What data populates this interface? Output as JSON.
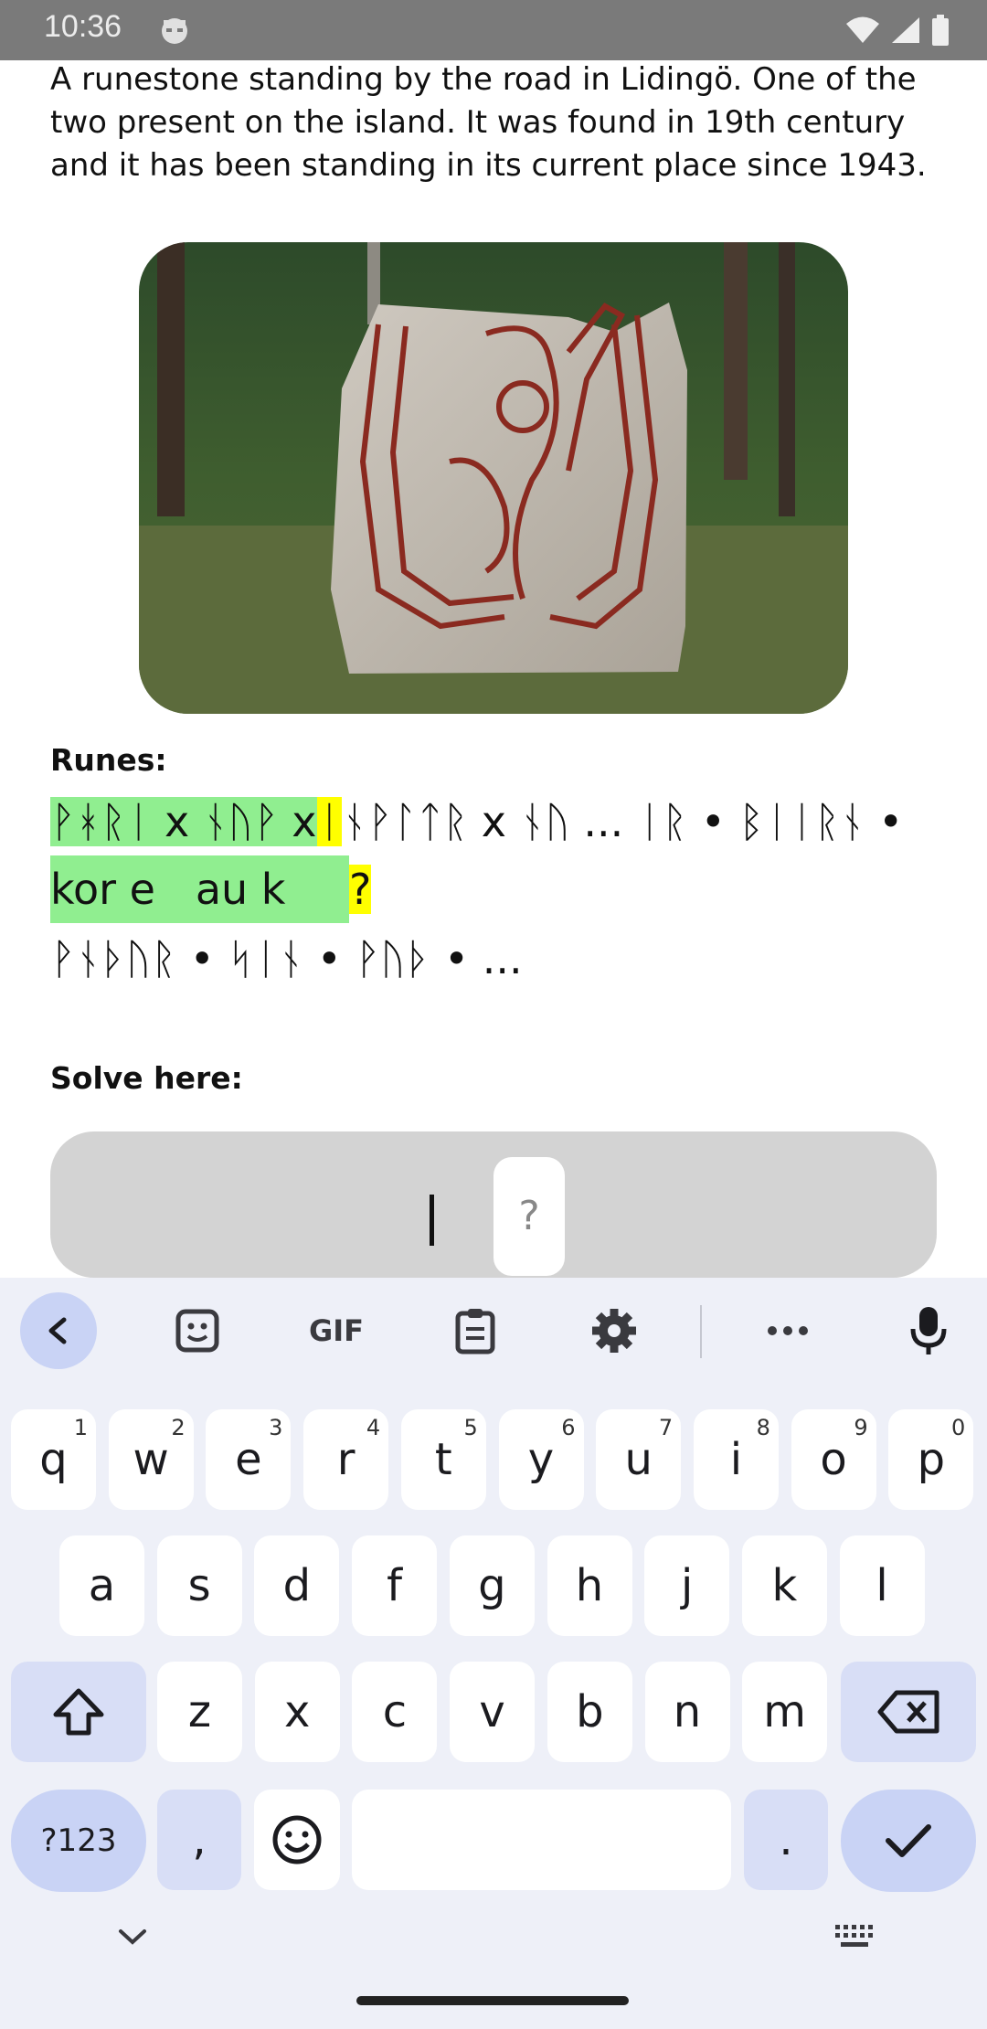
{
  "status": {
    "time": "10:36"
  },
  "content": {
    "description": "A runestone standing by the road in Lidingö. One of the two present on the island. It was found in 19th century and it has been standing in its current place since 1943.",
    "runes_heading": "Runes:",
    "runes": {
      "green": "ᚹᚼᚱᛁ x ᚾᚢᚹ x",
      "yellow": "ᛁ",
      "rest_line1": "ᚾᚹᛚᛏᚱ x ᚾᚢ ... ᛁᚱ • ᛒᛁᛁᚱᚾ •",
      "translit_green": "kor e   au k",
      "translit_yellow": "?",
      "line3": "ᚹᚾᚦᚢᚱ • ᛋᛁᚾ • ᚹᚢᚦ • ..."
    },
    "solve_heading": "Solve here:",
    "tile": "?"
  },
  "keyboard": {
    "row1": [
      {
        "k": "q",
        "h": "1"
      },
      {
        "k": "w",
        "h": "2"
      },
      {
        "k": "e",
        "h": "3"
      },
      {
        "k": "r",
        "h": "4"
      },
      {
        "k": "t",
        "h": "5"
      },
      {
        "k": "y",
        "h": "6"
      },
      {
        "k": "u",
        "h": "7"
      },
      {
        "k": "i",
        "h": "8"
      },
      {
        "k": "o",
        "h": "9"
      },
      {
        "k": "p",
        "h": "0"
      }
    ],
    "row2": [
      "a",
      "s",
      "d",
      "f",
      "g",
      "h",
      "j",
      "k",
      "l"
    ],
    "row3": [
      "z",
      "x",
      "c",
      "v",
      "b",
      "n",
      "m"
    ],
    "sym_label": "?123",
    "comma": ",",
    "period": ".",
    "gif": "GIF"
  }
}
